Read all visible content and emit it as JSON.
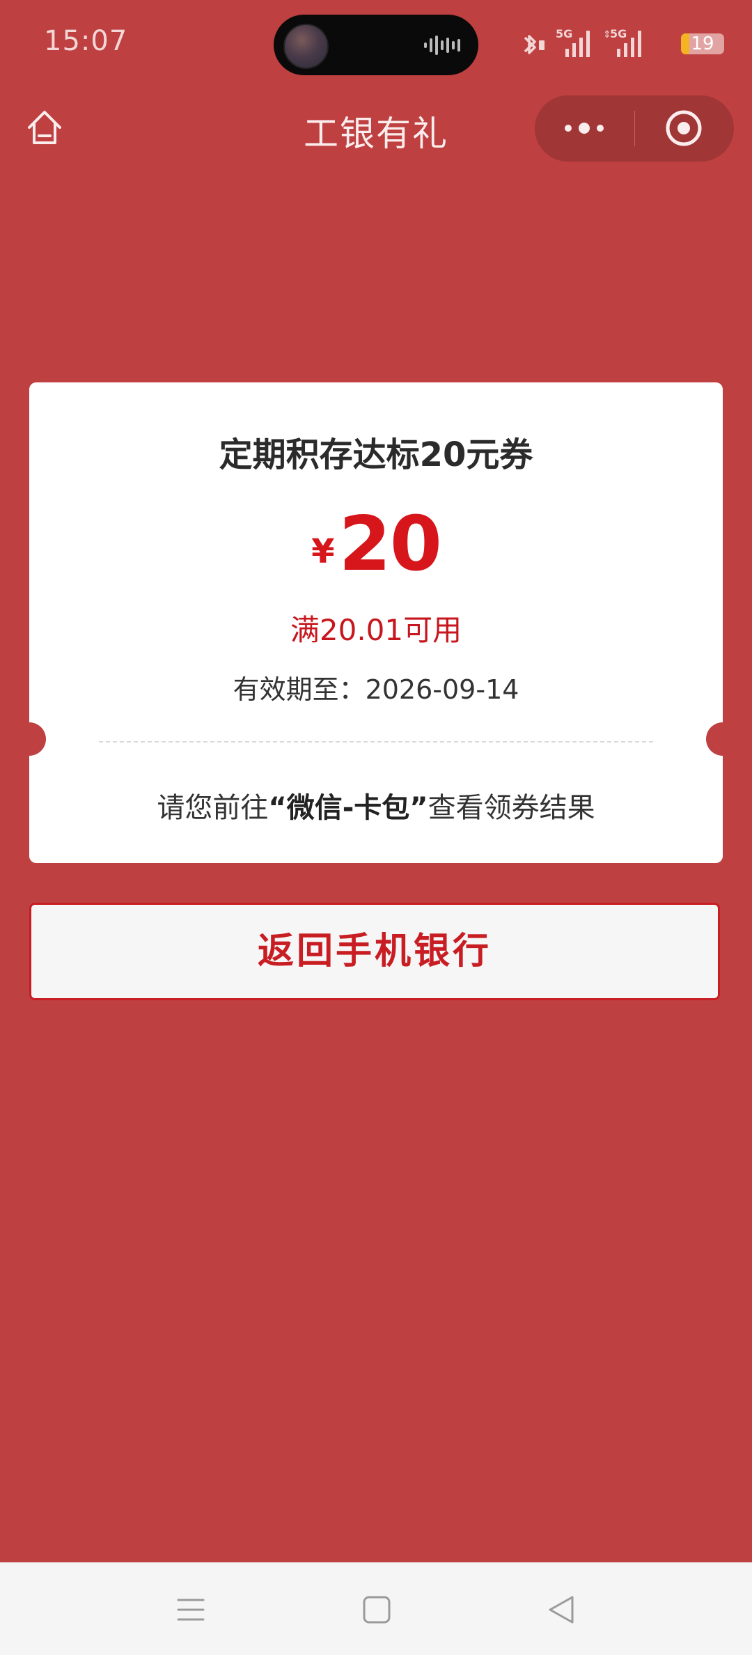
{
  "status_bar": {
    "time": "15:07",
    "battery": "19",
    "battery_level": 0.19,
    "icons": [
      "bluetooth-icon",
      "signal-5g-icon",
      "signal-5g-icon",
      "battery-icon"
    ]
  },
  "nav": {
    "title": "工银有礼",
    "home_icon": "home-icon",
    "more_icon": "more-dots-icon",
    "close_icon": "target-close-icon"
  },
  "coupon": {
    "title": "定期积存达标20元券",
    "currency": "¥",
    "amount": "20",
    "condition": "满20.01可用",
    "expiry": "有效期至：2026-09-14",
    "notice_prefix": "请您前往",
    "notice_highlight": "“微信-卡包”",
    "notice_suffix": "查看领券结果"
  },
  "actions": {
    "return_label": "返回手机银行"
  },
  "bottom_nav": {
    "icons": [
      "menu-icon",
      "home-square-icon",
      "back-triangle-icon"
    ]
  },
  "colors": {
    "background": "#BE4040",
    "accent_red": "#D7161C",
    "card": "#FFFFFF",
    "bottom_nav": "#F5F5F5"
  }
}
